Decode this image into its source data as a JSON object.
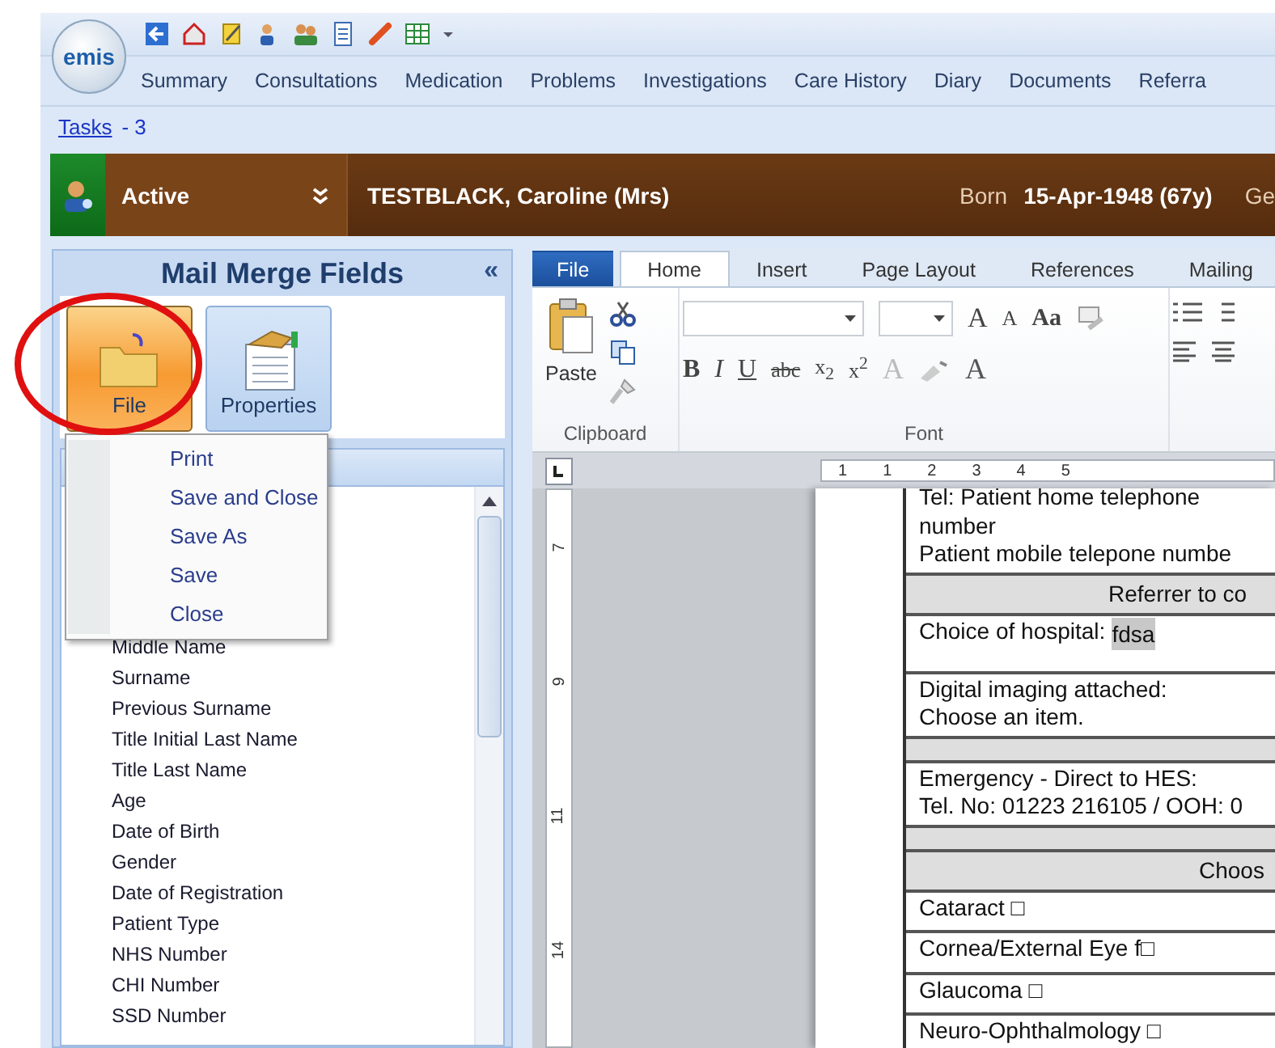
{
  "logo": "emis",
  "nav_tabs": [
    "Summary",
    "Consultations",
    "Medication",
    "Problems",
    "Investigations",
    "Care History",
    "Diary",
    "Documents",
    "Referra"
  ],
  "tasks": {
    "link": "Tasks",
    "count": "- 3"
  },
  "patient": {
    "status": "Active",
    "name": "TESTBLACK, Caroline  (Mrs)",
    "born_label": "Born",
    "born": "15-Apr-1948 (67y)",
    "column_5": "Ge"
  },
  "mail_merge": {
    "title": "Mail Merge Fields",
    "collapse": "«",
    "buttons": [
      {
        "label": "File",
        "kind": "file",
        "pressed": true
      },
      {
        "label": "Properties",
        "kind": "properties",
        "pressed": false
      }
    ],
    "menu": [
      "Print",
      "Save and Close",
      "Save As",
      "Save",
      "Close"
    ],
    "fields": [
      "Middle Name",
      "Surname",
      "Previous Surname",
      "Title Initial Last Name",
      "Title Last Name",
      "Age",
      "Date of Birth",
      "Gender",
      "Date of Registration",
      "Patient Type",
      "NHS Number",
      "CHI Number",
      "SSD Number"
    ]
  },
  "word": {
    "tabs": [
      {
        "label": "File",
        "kind": "backstage",
        "selected": false
      },
      {
        "label": "Home",
        "kind": "ribbon",
        "selected": true
      },
      {
        "label": "Insert",
        "kind": "ribbon",
        "selected": false
      },
      {
        "label": "Page Layout",
        "kind": "ribbon",
        "selected": false
      },
      {
        "label": "References",
        "kind": "ribbon",
        "selected": false
      },
      {
        "label": "Mailing",
        "kind": "ribbon",
        "selected": false
      }
    ],
    "clipboard": {
      "paste": "Paste",
      "label": "Clipboard"
    },
    "font": {
      "grow": "A",
      "shrink": "A",
      "case": "Aa",
      "format_buttons": [
        "B",
        "I",
        "U",
        "abc",
        "x$_{2}$",
        "x$^{2}$"
      ],
      "effects": "A",
      "font_color_button": "A",
      "label": "Font"
    },
    "ruler": [
      "1",
      "1",
      "2",
      "3",
      "4",
      "5"
    ],
    "vertical_ruler": [
      "7",
      "9",
      "11",
      "14"
    ],
    "document": [
      {
        "kind": "text",
        "lines": [
          "Tel:  Patient home telephone",
          "number",
          "Patient mobile telepone numbe"
        ]
      },
      {
        "kind": "header",
        "text": "Referrer to co"
      },
      {
        "kind": "field",
        "label": "Choice of hospital:",
        "value": "fdsa"
      },
      {
        "kind": "text",
        "lines": [
          "Digital imaging attached:",
          "Choose  an item."
        ]
      },
      {
        "kind": "blank"
      },
      {
        "kind": "text",
        "lines": [
          "Emergency  - Direct to HES:",
          "Tel. No: 01223 216105  / OOH: 0"
        ]
      },
      {
        "kind": "blank"
      },
      {
        "kind": "header",
        "text": "Choos"
      },
      {
        "kind": "text",
        "lines": [
          "Cataract  □"
        ]
      },
      {
        "kind": "text",
        "lines": [
          "Cornea/External  Eye f□"
        ]
      },
      {
        "kind": "text",
        "lines": [
          "Glaucoma □"
        ]
      },
      {
        "kind": "text",
        "lines": [
          "Neuro-Ophthalmology  □"
        ]
      }
    ]
  }
}
